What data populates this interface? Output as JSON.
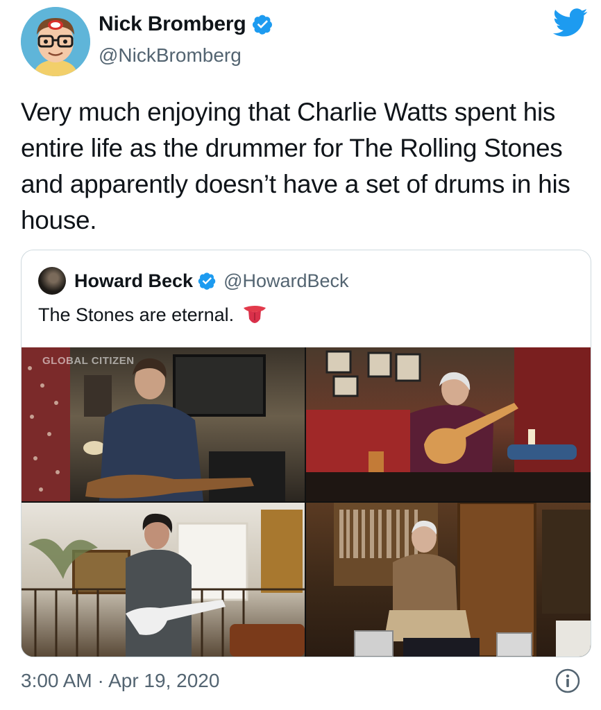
{
  "author": {
    "display_name": "Nick Bromberg",
    "handle": "@NickBromberg"
  },
  "tweet": {
    "text": "Very much enjoying that Charlie Watts spent his entire life as the drummer for The Rolling Stones and apparently doesn’t have a set of drums in his house."
  },
  "quoted_tweet": {
    "display_name": "Howard Beck",
    "handle": "@HowardBeck",
    "text": "The Stones are eternal.",
    "media_watermark": "GLOBAL CITIZEN"
  },
  "footer": {
    "timestamp": "3:00 AM · Apr 19, 2020"
  },
  "colors": {
    "twitter_blue": "#1d9bf0",
    "secondary_text": "#536471",
    "border": "#cfd9de"
  },
  "icons": [
    "verified-badge-icon",
    "twitter-bird-icon",
    "tongue-emoji-icon",
    "info-icon"
  ]
}
